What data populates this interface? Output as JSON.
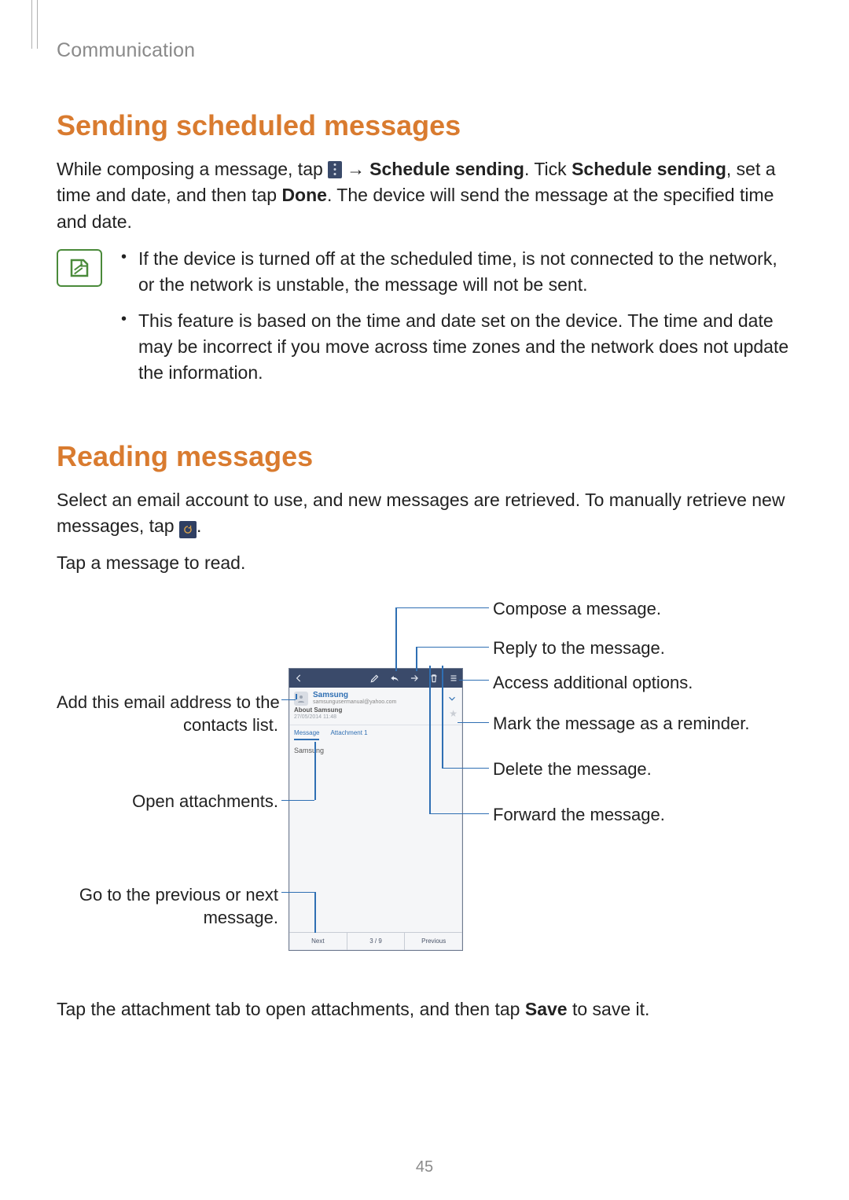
{
  "breadcrumb": "Communication",
  "page_number": "45",
  "section1": {
    "heading": "Sending scheduled messages",
    "p1_a": "While composing a message, tap ",
    "p1_b": " → ",
    "p1_c": "Schedule sending",
    "p1_d": ". Tick ",
    "p1_e": "Schedule sending",
    "p1_f": ", set a time and date, and then tap ",
    "p1_g": "Done",
    "p1_h": ". The device will send the message at the specified time and date.",
    "note1": "If the device is turned off at the scheduled time, is not connected to the network, or the network is unstable, the message will not be sent.",
    "note2": "This feature is based on the time and date set on the device. The time and date may be incorrect if you move across time zones and the network does not update the information."
  },
  "section2": {
    "heading": "Reading messages",
    "p1_a": "Select an email account to use, and new messages are retrieved. To manually retrieve new messages, tap ",
    "p1_b": ".",
    "p2": "Tap a message to read.",
    "p3_a": "Tap the attachment tab to open attachments, and then tap ",
    "p3_b": "Save",
    "p3_c": " to save it."
  },
  "callouts": {
    "compose": "Compose a message.",
    "reply": "Reply to the message.",
    "options": "Access additional options.",
    "mark": "Mark the message as a reminder.",
    "delete": "Delete the message.",
    "forward": "Forward the message.",
    "add_contact_l1": "Add this email address to the",
    "add_contact_l2": "contacts list.",
    "open_attach": "Open attachments.",
    "prevnext_l1": "Go to the previous or next",
    "prevnext_l2": "message."
  },
  "screenshot": {
    "sender_name": "Samsung",
    "sender_email": "samsungusermanual@yahoo.com",
    "subject": "About Samsung",
    "datetime": "27/05/2014  11:48",
    "tab_message": "Message",
    "tab_attachment": "Attachment 1",
    "body": "Samsung",
    "nav_next": "Next",
    "nav_count": "3 / 9",
    "nav_prev": "Previous"
  }
}
